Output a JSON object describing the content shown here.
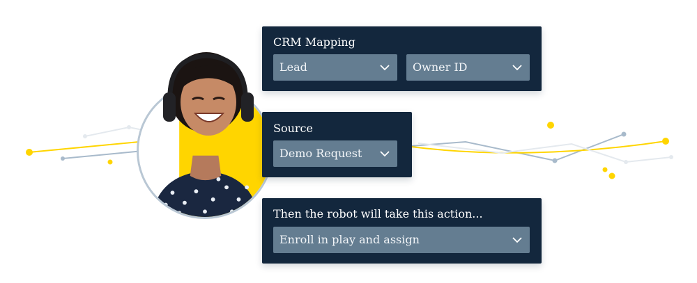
{
  "colors": {
    "panel": "#13273d",
    "dropdown": "#647d91",
    "accent_yellow": "#ffd500",
    "line_blue": "#a8bacb",
    "line_light": "#e4e9ee"
  },
  "crm_panel": {
    "title": "CRM Mapping",
    "dropdown_1": {
      "value": "Lead",
      "icon": "chevron-down-icon"
    },
    "dropdown_2": {
      "value": "Owner ID",
      "icon": "chevron-down-icon"
    }
  },
  "source_panel": {
    "title": "Source",
    "dropdown": {
      "value": "Demo Request",
      "icon": "chevron-down-icon"
    }
  },
  "action_panel": {
    "title": "Then the robot will take this action...",
    "dropdown": {
      "value": "Enroll in play and assign",
      "icon": "chevron-down-icon"
    }
  },
  "avatar": {
    "icon": "person-headset-photo"
  }
}
